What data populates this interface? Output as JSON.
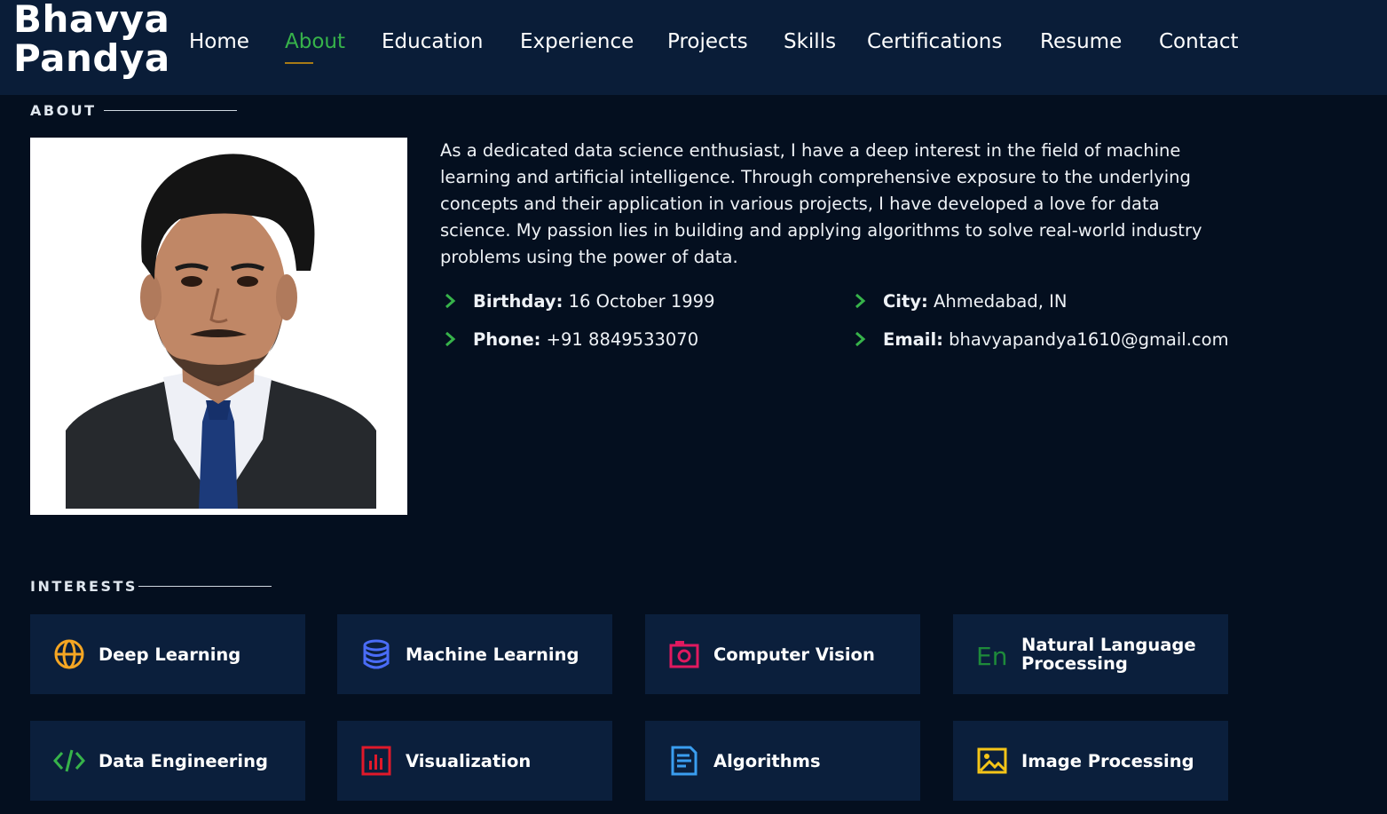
{
  "logo": {
    "line1": "Bhavya",
    "line2": "Pandya"
  },
  "nav": {
    "items": [
      {
        "label": "Home",
        "active": false
      },
      {
        "label": "About",
        "active": true
      },
      {
        "label": "Education",
        "active": false
      },
      {
        "label": "Experience",
        "active": false
      },
      {
        "label": "Projects",
        "active": false
      },
      {
        "label": "Skills",
        "active": false
      },
      {
        "label": "Certifications",
        "active": false
      },
      {
        "label": "Resume",
        "active": false
      },
      {
        "label": "Contact",
        "active": false
      }
    ]
  },
  "about": {
    "title": "ABOUT",
    "photo_icon": "profile-photo",
    "text": "As a dedicated data science enthusiast, I have a deep interest in the field of machine learning and artificial intelligence. Through comprehensive exposure to the underlying concepts and their application in various projects, I have developed a love for data science. My passion lies in building and applying algorithms to solve real-world industry problems using the power of data.",
    "info": [
      {
        "key": "Birthday:",
        "value": " 16 October 1999"
      },
      {
        "key": "City:",
        "value": " Ahmedabad, IN"
      },
      {
        "key": "Phone:",
        "value": " +91 8849533070"
      },
      {
        "key": "Email:",
        "value": " bhavyapandya1610@gmail.com"
      }
    ]
  },
  "interests": {
    "title": "INTERESTS",
    "items": [
      {
        "label": "Deep Learning",
        "icon": "globe-icon",
        "color": "#f5a623"
      },
      {
        "label": "Machine Learning",
        "icon": "database-icon",
        "color": "#4a6cf7"
      },
      {
        "label": "Computer Vision",
        "icon": "camera-icon",
        "color": "#e0195f"
      },
      {
        "label": "Natural Language Processing",
        "icon": "language-icon",
        "color": "#1e8a3a"
      },
      {
        "label": "Data Engineering",
        "icon": "code-icon",
        "color": "#37b34a"
      },
      {
        "label": "Visualization",
        "icon": "bar-chart-icon",
        "color": "#e0192a"
      },
      {
        "label": "Algorithms",
        "icon": "document-icon",
        "color": "#3a9ef0"
      },
      {
        "label": "Image Processing",
        "icon": "image-icon",
        "color": "#f5c518"
      }
    ]
  },
  "colors": {
    "accent": "#37b34a",
    "header_bg": "#0a1d38",
    "page_bg": "#040f1f",
    "card_bg": "#0b1f3c"
  }
}
